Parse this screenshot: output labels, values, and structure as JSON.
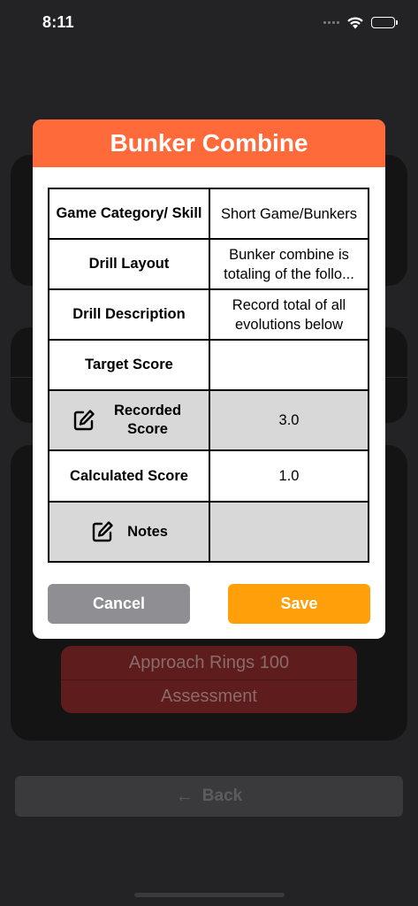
{
  "status_bar": {
    "time": "8:11"
  },
  "background": {
    "items": [
      "Approach Rings 100",
      "Assessment"
    ],
    "back_label": "Back"
  },
  "modal": {
    "title": "Bunker Combine",
    "rows": [
      {
        "label": "Game Category/ Skill",
        "value": "Short Game/Bunkers"
      },
      {
        "label": "Drill Layout",
        "value": "Bunker combine is totaling of the follo..."
      },
      {
        "label": "Drill Description",
        "value": "Record total of all evolutions below"
      },
      {
        "label": "Target Score",
        "value": ""
      },
      {
        "label": "Recorded Score",
        "value": "3.0",
        "icon": "edit-icon"
      },
      {
        "label": "Calculated Score",
        "value": "1.0"
      },
      {
        "label": "Notes",
        "value": "",
        "icon": "edit-icon"
      }
    ],
    "cancel_label": "Cancel",
    "save_label": "Save"
  },
  "colors": {
    "header": "#ff6a3a",
    "save": "#ff9f0a",
    "cancel": "#8e8e93",
    "highlight_row": "#d8d8d8"
  }
}
